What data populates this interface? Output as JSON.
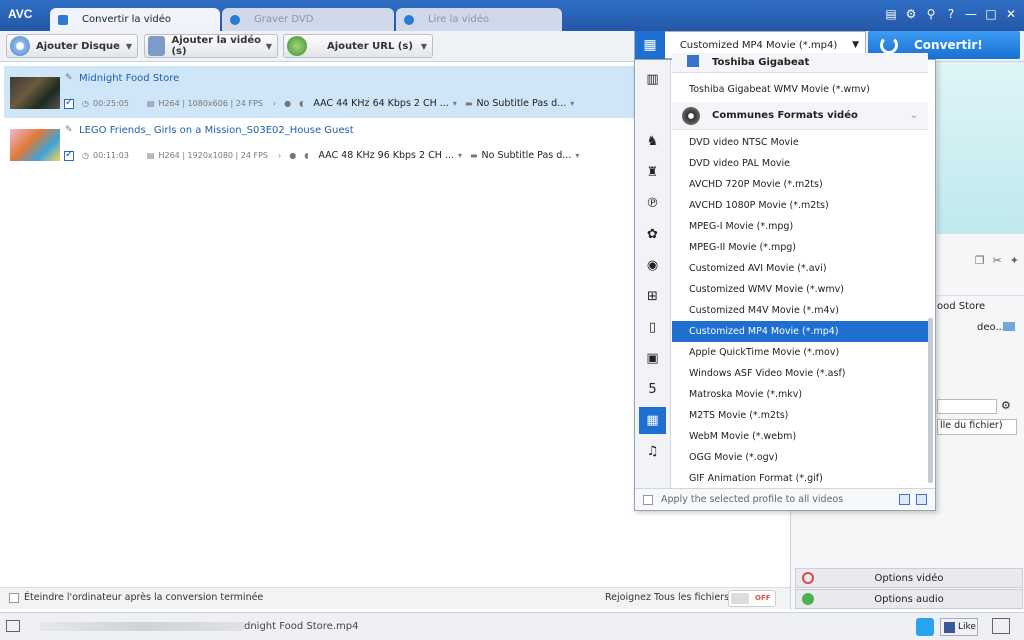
{
  "app": {
    "logo": "AVC"
  },
  "tabs": [
    {
      "label": "Convertir la vidéo",
      "active": true
    },
    {
      "label": "Graver DVD",
      "active": false
    },
    {
      "label": "Lire la vidéo",
      "active": false
    }
  ],
  "window_controls": [
    "list-icon",
    "gear-icon",
    "key-icon",
    "help-icon",
    "minimize-icon",
    "maximize-icon",
    "close-icon"
  ],
  "window_glyphs": {
    "list": "▤",
    "settings": "⚙",
    "key": "⚲",
    "help": "?",
    "minimize": "—",
    "maximize": "□",
    "close": "✕"
  },
  "toolbar": {
    "add_disc": "Ajouter Disque",
    "add_video": "Ajouter la vidéo (s)",
    "add_url": "Ajouter URL (s)"
  },
  "profile": {
    "selected": "Customized MP4 Movie (*.mp4)"
  },
  "convert_label": "Convertir!",
  "files": [
    {
      "name": "Midnight Food Store",
      "duration": "00:25:05",
      "codec": "H264 | 1080x606 | 24 FPS",
      "audio": "AAC 44 KHz 64 Kbps 2 CH ...",
      "subtitle": "No Subtitle Pas d..."
    },
    {
      "name": "LEGO Friends_ Girls on a Mission_S03E02_House Guest",
      "duration": "00:11:03",
      "codec": "H264 | 1920x1080 | 24 FPS",
      "audio": "AAC 48 KHz 96 Kbps 2 CH ...",
      "subtitle": "No Subtitle Pas d..."
    }
  ],
  "dropdown": {
    "groups": [
      "Toshiba Gigabeat",
      "Communes Formats vidéo"
    ],
    "toshiba_items": [
      "Toshiba Gigabeat WMV Movie (*.wmv)"
    ],
    "items": [
      "DVD video NTSC Movie",
      "DVD video PAL Movie",
      "AVCHD 720P Movie (*.m2ts)",
      "AVCHD 1080P Movie (*.m2ts)",
      "MPEG-I Movie (*.mpg)",
      "MPEG-II Movie (*.mpg)",
      "Customized AVI Movie (*.avi)",
      "Customized WMV Movie (*.wmv)",
      "Customized M4V Movie (*.m4v)",
      "Customized MP4 Movie (*.mp4)",
      "Apple QuickTime Movie (*.mov)",
      "Windows ASF Video Movie (*.asf)",
      "Matroska Movie (*.mkv)",
      "M2TS Movie (*.m2ts)",
      "WebM Movie (*.webm)",
      "OGG Movie (*.ogv)",
      "GIF Animation Format (*.gif)"
    ],
    "selected_index": 9,
    "apply_label": "Apply the selected profile to all videos",
    "categories": [
      "gauge-icon",
      "apple-icon",
      "android-robot-icon",
      "android-icon",
      "playstation-icon",
      "huawei-icon",
      "lg-icon",
      "windows-icon",
      "phone-icon",
      "tv-icon",
      "html5-icon",
      "film-icon",
      "music-icon"
    ],
    "category_glyphs": [
      "▥",
      "",
      "♞",
      "♜",
      "℗",
      "✿",
      "◉",
      "⊞",
      "▯",
      "▣",
      "5",
      "▦",
      "♫"
    ]
  },
  "right_panel": {
    "partial_filename": "ood Store",
    "partial_path": "deo...",
    "partial_option": "lle du fichier)",
    "video_options": "Options vidéo",
    "audio_options": "Options audio"
  },
  "bottom": {
    "shutdown": "Éteindre l'ordinateur après la conversion terminée",
    "join_all": "Rejoignez Tous les fichiers",
    "toggle": "OFF"
  },
  "status": {
    "file": "dnight Food Store.mp4",
    "like": "Like"
  }
}
